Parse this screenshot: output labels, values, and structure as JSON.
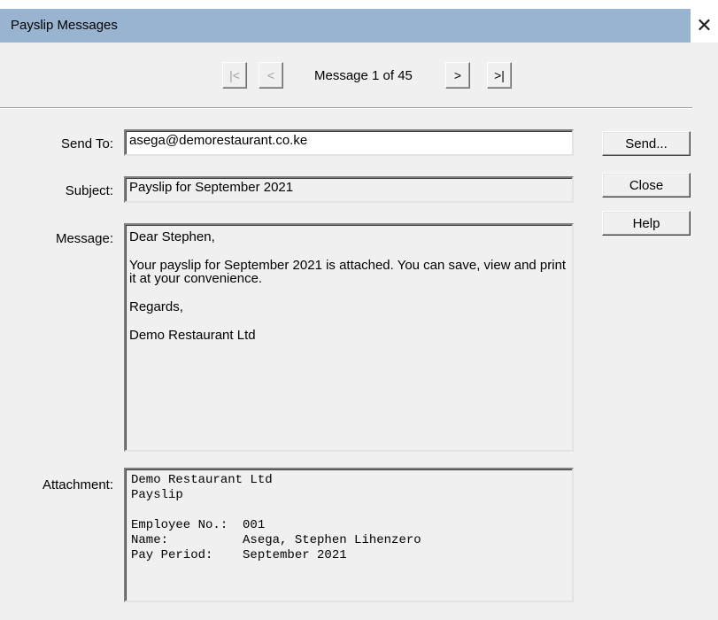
{
  "window": {
    "title": "Payslip Messages",
    "close_glyph": "✕"
  },
  "nav": {
    "first_glyph": "|<",
    "prev_glyph": "<",
    "label": "Message 1 of 45",
    "next_glyph": ">",
    "last_glyph": ">|"
  },
  "form": {
    "send_to_label": "Send To:",
    "send_to_value": "asega@demorestaurant.co.ke",
    "subject_label": "Subject:",
    "subject_value": "Payslip for September 2021",
    "message_label": "Message:",
    "message_lines": [
      "Dear Stephen,",
      "Your payslip for September 2021 is attached. You can save, view and print it at your convenience.",
      "Regards,",
      "Demo Restaurant Ltd"
    ],
    "attachment_label": "Attachment:",
    "attachment_lines": [
      "Demo Restaurant Ltd",
      "Payslip",
      "",
      "Employee No.:  001",
      "Name:          Asega, Stephen Lihenzero",
      "Pay Period:    September 2021"
    ]
  },
  "buttons": {
    "send": "Send...",
    "close": "Close",
    "help": "Help"
  },
  "colors": {
    "title_bar": "#99b4d1",
    "dialog_bg": "#f0f0f0"
  }
}
